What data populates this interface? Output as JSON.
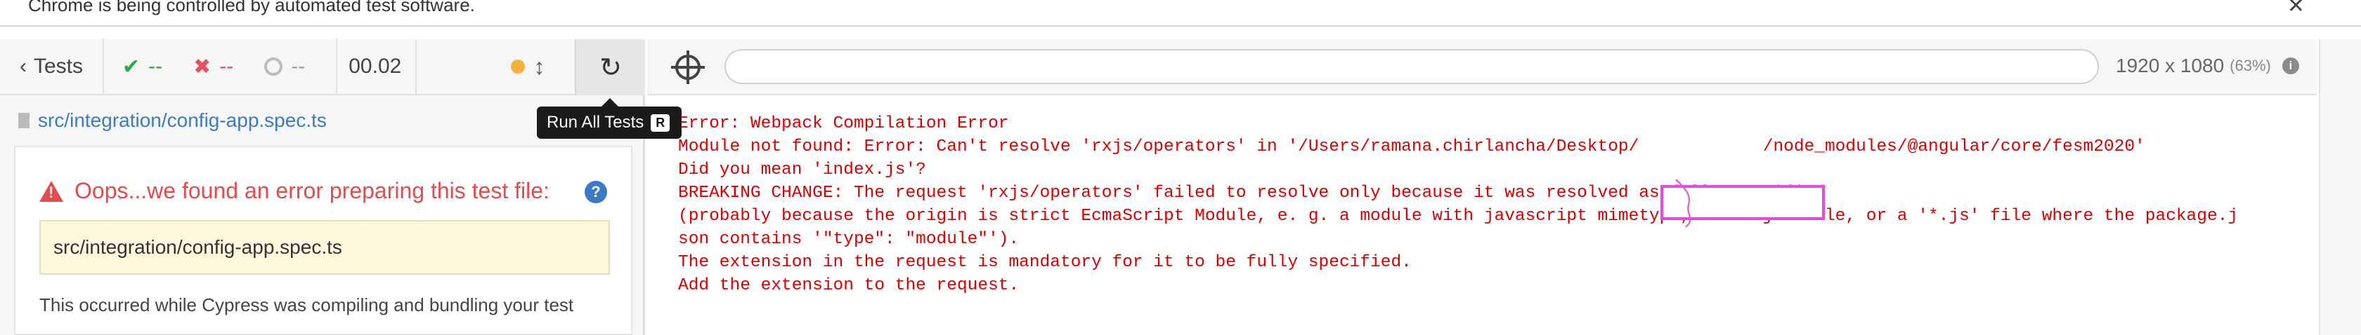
{
  "banner": {
    "text": "Chrome is being controlled by automated test software.",
    "close_icon": "close-icon"
  },
  "reporter": {
    "tests_label": "Tests",
    "passed": "--",
    "failed": "--",
    "pending": "--",
    "duration": "00.02",
    "spec_path": "src/integration/config-app.spec.ts",
    "tooltip_label": "Run All Tests",
    "tooltip_key": "R",
    "error_title": "Oops...we found an error preparing this test file:",
    "error_spec": "src/integration/config-app.spec.ts",
    "occurred_text": "This occurred while Cypress was compiling and bundling your test"
  },
  "runner": {
    "viewport_size": "1920 x 1080",
    "viewport_pct": "(63%)",
    "url": ""
  },
  "error_lines": [
    "Error: Webpack Compilation Error",
    "Module not found: Error: Can't resolve 'rxjs/operators' in '/Users/ramana.chirlancha/Desktop/            /node_modules/@angular/core/fesm2020'",
    "Did you mean 'index.js'?",
    "BREAKING CHANGE: The request 'rxjs/operators' failed to resolve only because it was resolved as fully specified",
    "(probably because the origin is strict EcmaScript Module, e. g. a module with javascript mimetype, a '*.mjs' file, or a '*.js' file where the package.j",
    "son contains '\"type\": \"module\"').",
    "The extension in the request is mandatory for it to be fully specified.",
    "Add the extension to the request."
  ],
  "colors": {
    "pass": "#28a745",
    "fail": "#e94f5f",
    "error_text": "#d80000",
    "link": "#3a7ac7",
    "redaction": "#e44ce0"
  }
}
